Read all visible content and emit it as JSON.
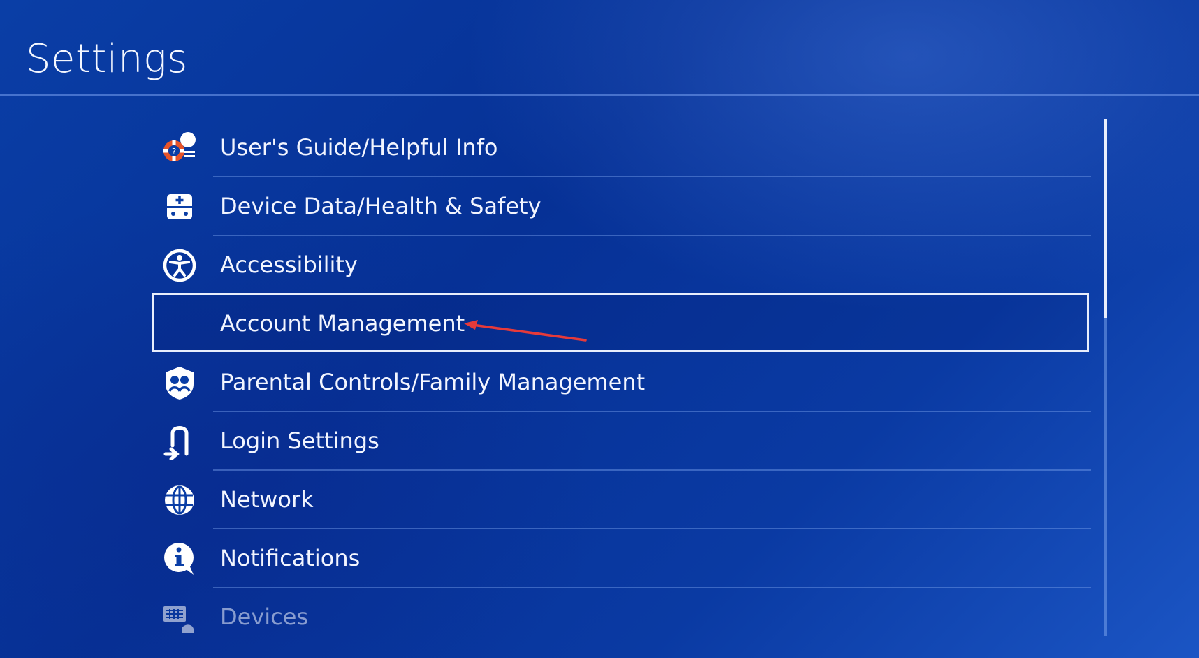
{
  "page": {
    "title": "Settings"
  },
  "menu": {
    "items": [
      {
        "label": "User's Guide/Helpful Info",
        "icon": "help-lifebuoy-icon"
      },
      {
        "label": "Device Data/Health & Safety",
        "icon": "device-data-icon"
      },
      {
        "label": "Accessibility",
        "icon": "accessibility-icon"
      },
      {
        "label": "Account Management",
        "icon": "",
        "selected": true
      },
      {
        "label": "Parental Controls/Family Management",
        "icon": "family-icon"
      },
      {
        "label": "Login Settings",
        "icon": "login-icon"
      },
      {
        "label": "Network",
        "icon": "globe-icon"
      },
      {
        "label": "Notifications",
        "icon": "info-bubble-icon"
      },
      {
        "label": "Devices",
        "icon": "keyboard-icon"
      }
    ]
  },
  "colors": {
    "background": "#0a3ea6",
    "selection_border": "#e8eefc",
    "annotation_arrow": "#e63a3a"
  }
}
